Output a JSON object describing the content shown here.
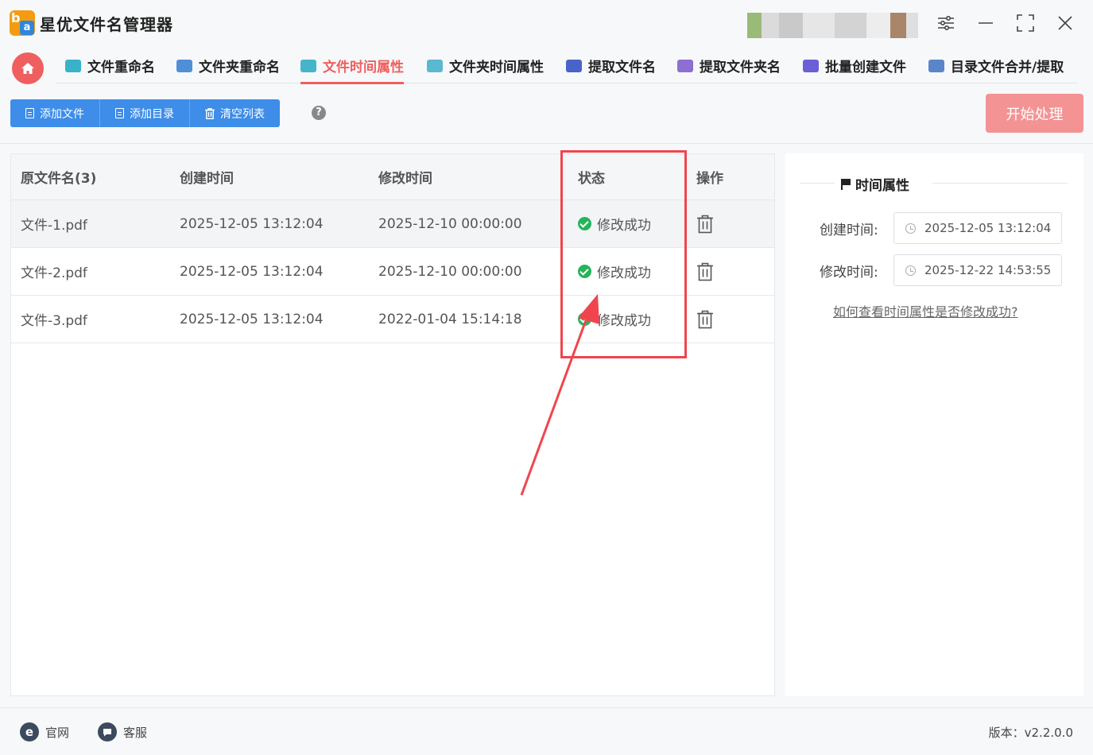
{
  "app": {
    "title": "星优文件名管理器"
  },
  "nav": {
    "tabs": [
      {
        "label": "文件重命名",
        "color": "#38b2c8"
      },
      {
        "label": "文件夹重命名",
        "color": "#4f8fd8"
      },
      {
        "label": "文件时间属性",
        "color": "#45b5c9",
        "active": true
      },
      {
        "label": "文件夹时间属性",
        "color": "#5ab8d0"
      },
      {
        "label": "提取文件名",
        "color": "#4a63c9"
      },
      {
        "label": "提取文件夹名",
        "color": "#8c6fd1"
      },
      {
        "label": "批量创建文件",
        "color": "#6a5fd6"
      },
      {
        "label": "目录文件合并/提取",
        "color": "#5a86c9"
      }
    ]
  },
  "toolbar": {
    "add_file": "添加文件",
    "add_dir": "添加目录",
    "clear_list": "清空列表",
    "help": "?",
    "start": "开始处理"
  },
  "table": {
    "headers": {
      "name": "原文件名(3)",
      "created": "创建时间",
      "modified": "修改时间",
      "status": "状态",
      "action": "操作"
    },
    "rows": [
      {
        "name": "文件-1.pdf",
        "created": "2025-12-05 13:12:04",
        "modified": "2025-12-10 00:00:00",
        "status": "修改成功"
      },
      {
        "name": "文件-2.pdf",
        "created": "2025-12-05 13:12:04",
        "modified": "2025-12-10 00:00:00",
        "status": "修改成功"
      },
      {
        "name": "文件-3.pdf",
        "created": "2025-12-05 13:12:04",
        "modified": "2022-01-04 15:14:18",
        "status": "修改成功"
      }
    ]
  },
  "panel": {
    "title": "时间属性",
    "created_label": "创建时间:",
    "created_value": "2025-12-05 13:12:04",
    "modified_label": "修改时间:",
    "modified_value": "2025-12-22 14:53:55",
    "help_link": "如何查看时间属性是否修改成功?"
  },
  "footer": {
    "website": "官网",
    "website_icon": "e",
    "support": "客服",
    "version": "版本：v2.2.0.0"
  },
  "colors": {
    "accent": "#ef5f5f",
    "primary": "#3d8de9",
    "success": "#25b45a",
    "annotation": "#f0454e"
  }
}
